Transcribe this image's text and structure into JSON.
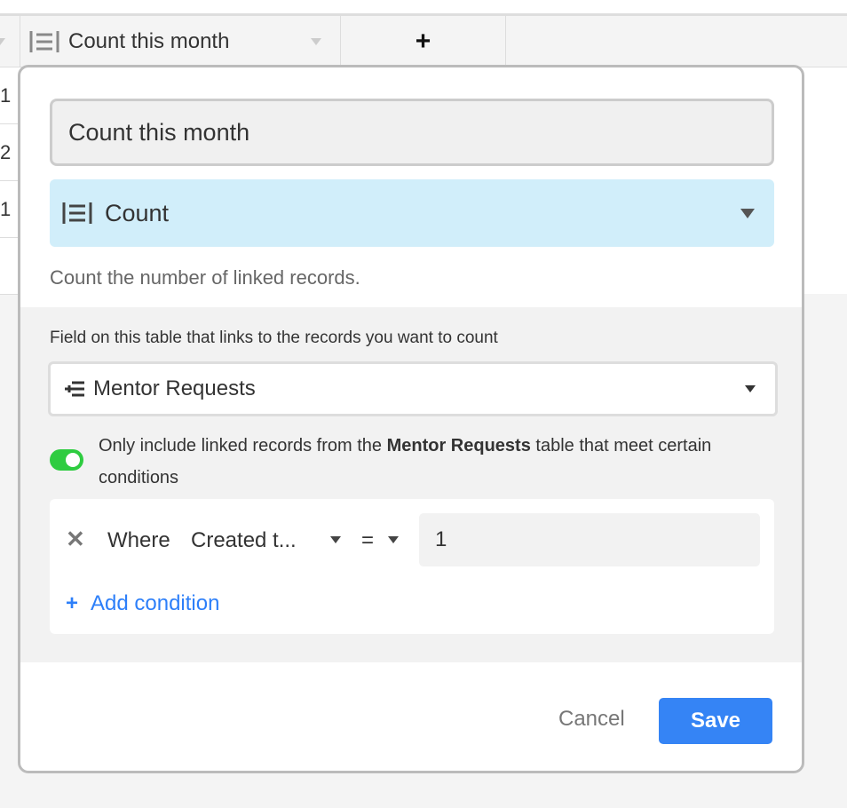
{
  "grid": {
    "column_title": "Count this month",
    "add_column": "+",
    "row_values": [
      "1",
      "2",
      "1",
      ""
    ]
  },
  "popup": {
    "field_name": "Count this month",
    "field_type": "Count",
    "type_description": "Count the number of linked records.",
    "link_label": "Field on this table that links to the records you want to count",
    "link_field": "Mentor Requests",
    "toggle_on": true,
    "toggle_text_pre": "Only include linked records from the ",
    "toggle_text_bold": "Mentor Requests",
    "toggle_text_post": " table that meet certain conditions",
    "condition": {
      "prefix": "Where",
      "field": "Created t...",
      "operator": "=",
      "value": "1"
    },
    "add_condition": "Add condition",
    "cancel": "Cancel",
    "save": "Save"
  },
  "colors": {
    "accent": "#3584f5",
    "toggle": "#2ecc40",
    "type_bg": "#d1eefa"
  }
}
